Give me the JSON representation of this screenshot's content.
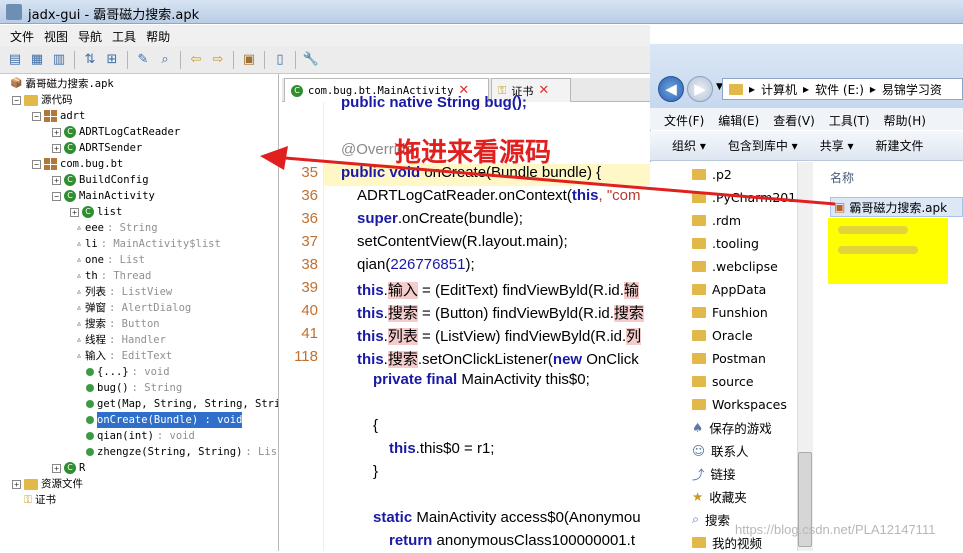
{
  "window": {
    "title": "jadx-gui - 霸哥磁力搜索.apk"
  },
  "menu": [
    "文件",
    "视图",
    "导航",
    "工具",
    "帮助"
  ],
  "toolbar_icons": [
    "open-icon",
    "save-all-icon",
    "export-icon",
    "sync-icon",
    "flatten-icon",
    "wand-icon",
    "search-icon",
    "back-icon",
    "forward-icon",
    "log-icon",
    "deobf-icon",
    "prefs-icon"
  ],
  "tree": {
    "root": "霸哥磁力搜索.apk",
    "source": "源代码",
    "pkg_adrt": "adrt",
    "adrt_logcat": "ADRTLogCatReader",
    "adrt_sender": "ADRTSender",
    "pkg_bug": "com.bug.bt",
    "buildconfig": "BuildConfig",
    "mainactivity": "MainActivity",
    "list": "list",
    "f_eee": "eee",
    "f_eee_t": " : String",
    "f_li": "li",
    "f_li_t": " : MainActivity$list",
    "f_one": "one",
    "f_one_t": " : List",
    "f_th": "th",
    "f_th_t": " : Thread",
    "f_lb": "列表",
    "f_lb_t": " : ListView",
    "f_tc": "弹窗",
    "f_tc_t": " : AlertDialog",
    "f_ss": "搜索",
    "f_ss_t": " : Button",
    "f_ck": "线程",
    "f_ck_t": " : Handler",
    "f_sr": "输入",
    "f_sr_t": " : EditText",
    "m_static": "{...}",
    "m_static_t": " : void",
    "m_bug": "bug()",
    "m_bug_t": " : String",
    "m_get": "get(Map, String, String, Stri",
    "m_oncreate": "onCreate(Bundle)",
    "m_oncreate_t": " : void",
    "m_qian": "qian(int)",
    "m_qian_t": " : void",
    "m_zhengze": "zhengze(String, String)",
    "m_zhengze_t": " : Lis",
    "r": "R",
    "resources": "资源文件",
    "cert": "证书"
  },
  "tabs": [
    {
      "label": "com.bug.bt.MainActivity"
    },
    {
      "label": "证书"
    }
  ],
  "code": {
    "l0": "public native String bug();",
    "l1": "@Override",
    "l2a": "public void",
    "l2b": " onCreate(Bundle bundle) {",
    "l3a": "ADRTLogCatReader.onContext(",
    "l3b": "this",
    ", ": "",
    "l3c": ", \"com",
    "l4a": "super",
    ".": "",
    "l4b": ".onCreate(bundle);",
    "l5": "setContentView(R.layout.main);",
    "l6a": "qian(",
    "l6b": "226776851",
    "l6c": ");",
    "l7a": "this",
    "l7b": "输入",
    "l7c": " = (EditText) findViewByld(R.id.",
    "l7d": "输",
    "l8a": "this",
    "l8b": "搜索",
    "l8c": " = (Button) findViewByld(R.id.",
    "l8d": "搜索",
    "l9a": "this",
    "l9b": "列表",
    "l9c": " = (ListView) findViewByld(R.id.",
    "l9d": "列",
    "l10a": "this",
    "l10b": "搜索",
    "l10c": ".setOnClickListener(",
    "l10d": "new",
    " l10e": "",
    "l10e": " OnClick",
    "l11a": "private final",
    " l11b": "",
    "l11b": " MainActivity this$0;",
    "l12": "{",
    "l13a": "this",
    "l13b": ".this$0 = r1;",
    "l14": "}",
    "l15a": "static",
    "l15b": " MainActivity access$0(Anonymou",
    "l16a": "return",
    "l16b": " anonymousClass100000001.t"
  },
  "line_numbers": [
    "35",
    "36",
    "36",
    "37",
    "38",
    "39",
    "40",
    "41",
    "118"
  ],
  "explorer": {
    "address": [
      "计算机",
      "软件 (E:)",
      "易锦学习资"
    ],
    "menu": [
      "文件(F)",
      "编辑(E)",
      "查看(V)",
      "工具(T)",
      "帮助(H)"
    ],
    "commands": [
      "组织 ▾",
      "包含到库中 ▾",
      "共享 ▾",
      "新建文件"
    ],
    "nav": [
      ".p2",
      ".PyCharm2019",
      ".rdm",
      ".tooling",
      ".webclipse",
      "AppData",
      "Funshion",
      "Oracle",
      "Postman",
      "source",
      "Workspaces",
      "保存的游戏",
      "联系人",
      "链接",
      "收藏夹",
      "搜索",
      "我的视频"
    ],
    "column": "名称",
    "file": "霸哥磁力搜索.apk"
  },
  "annotation": "拖进来看源码",
  "watermark": "https://blog.csdn.net/PLA12147111",
  "colors": {
    "annotation": "#e0201e",
    "highlight": "#ffff00",
    "keyword": "#1a1aa6"
  }
}
